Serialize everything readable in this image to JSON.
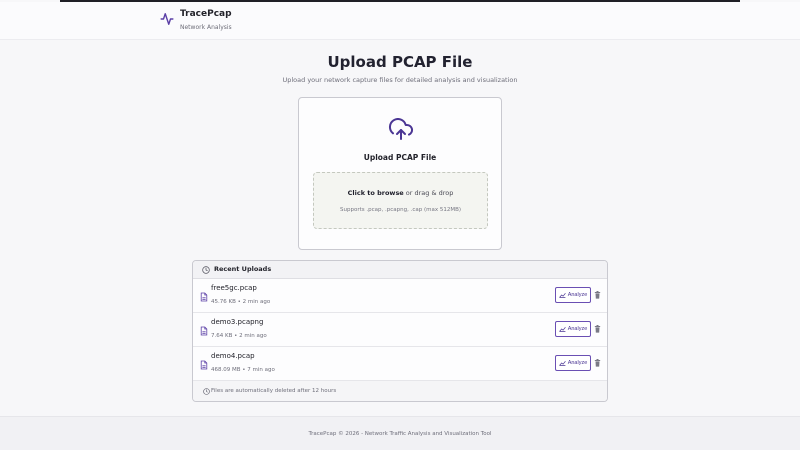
{
  "app": {
    "name": "TracePcap",
    "tagline": "Network Analysis"
  },
  "page": {
    "title": "Upload PCAP File",
    "subtitle": "Upload your network capture files for detailed analysis and visualization"
  },
  "upload_card": {
    "title": "Upload PCAP File",
    "browse_label": "Click to browse",
    "drag_label": " or drag & drop",
    "supports": "Supports .pcap, .pcapng, .cap (max 512MB)"
  },
  "recent": {
    "title": "Recent Uploads",
    "analyze_label": "Analyze",
    "items": [
      {
        "name": "free5gc.pcap",
        "meta": "45.76 KB • 2 min ago"
      },
      {
        "name": "demo3.pcapng",
        "meta": "7.64 KB • 2 min ago"
      },
      {
        "name": "demo4.pcap",
        "meta": "468.09 MB • 7 min ago"
      }
    ],
    "note": "Files are automatically deleted after 12 hours"
  },
  "footer": {
    "text": "TracePcap © 2026 - Network Traffic Analysis and Visualization Tool"
  },
  "colors": {
    "accent": "#4b3694"
  },
  "icons": [
    "activity-icon",
    "cloud-upload-icon",
    "clock-icon",
    "file-icon",
    "chart-icon",
    "trash-icon",
    "info-icon"
  ]
}
